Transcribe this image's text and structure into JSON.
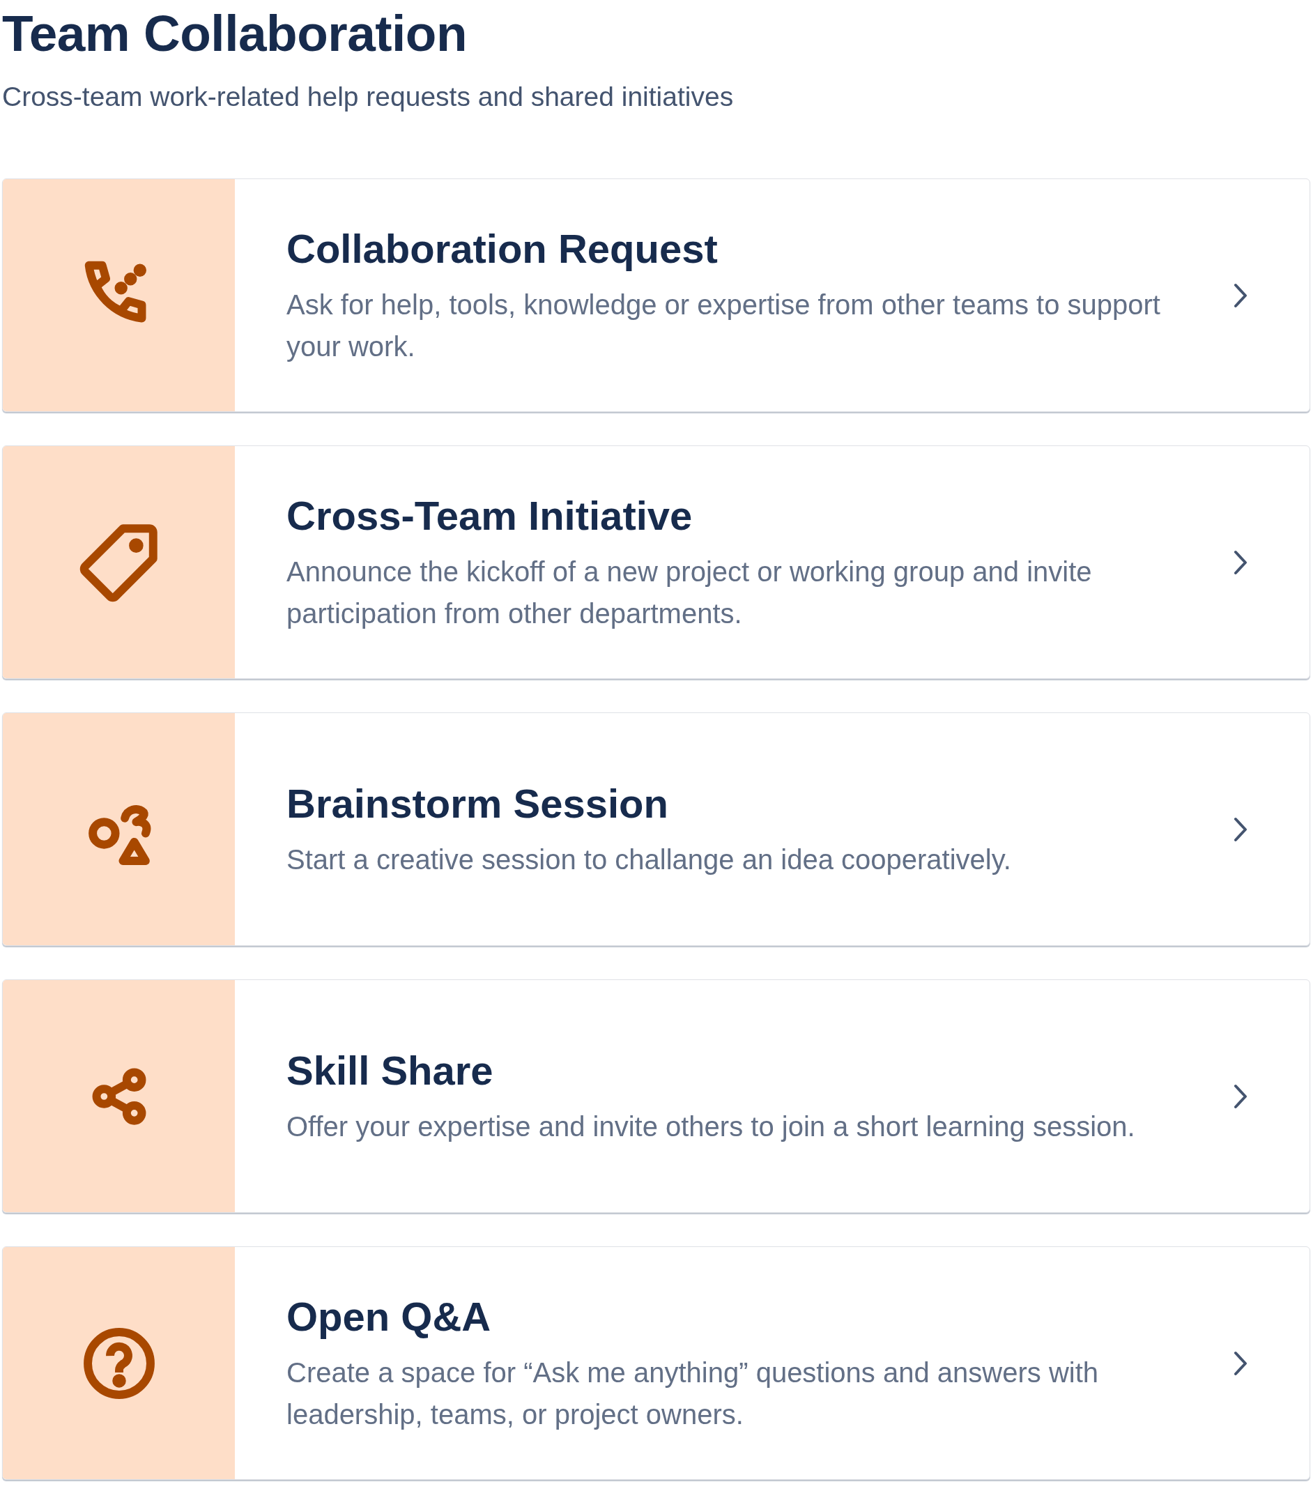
{
  "header": {
    "title": "Team Collaboration",
    "subtitle": "Cross-team work-related help requests and shared initiatives"
  },
  "cards": [
    {
      "kind": "phone",
      "title": "Collaboration Request",
      "description": "Ask for help, tools, knowledge or expertise from other teams to support your work."
    },
    {
      "kind": "tag",
      "title": "Cross-Team Initiative",
      "description": "Announce the kickoff of a new project or working group and invite participation from other departments."
    },
    {
      "kind": "shapes",
      "title": "Brainstorm Session",
      "description": "Start a creative session to challange an idea cooperatively."
    },
    {
      "kind": "share",
      "title": "Skill Share",
      "description": "Offer your expertise and invite others to join a short learning session."
    },
    {
      "kind": "question",
      "title": "Open Q&A",
      "description": "Create a space for “Ask me anything” questions and answers with leadership, teams, or project owners."
    }
  ]
}
